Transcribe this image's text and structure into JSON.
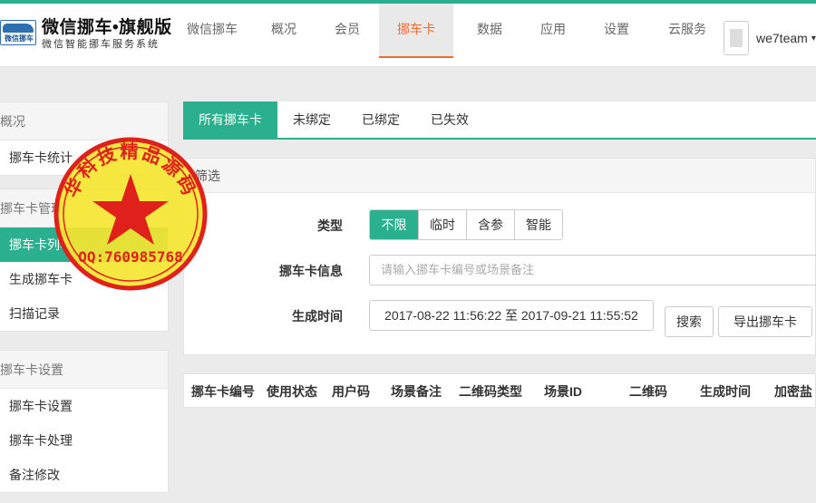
{
  "header": {
    "logo_text": "微信挪车",
    "title": "微信挪车•旗舰版",
    "subtitle": "微信智能挪车服务系统",
    "nav": [
      {
        "label": "微信挪车"
      },
      {
        "label": "概况"
      },
      {
        "label": "会员"
      },
      {
        "label": "挪车卡"
      },
      {
        "label": "数据"
      },
      {
        "label": "应用"
      },
      {
        "label": "设置"
      },
      {
        "label": "云服务"
      }
    ],
    "active_nav": "挪车卡",
    "username": "we7team",
    "caret": "▾"
  },
  "sidebar": {
    "sections": [
      {
        "title": "概况",
        "items": [
          "挪车卡统计"
        ]
      },
      {
        "title": "挪车卡管理",
        "items": [
          "挪车卡列表",
          "生成挪车卡",
          "扫描记录"
        ]
      },
      {
        "title": "挪车卡设置",
        "items": [
          "挪车卡设置",
          "挪车卡处理",
          "备注修改"
        ]
      }
    ],
    "active_item": "挪车卡列表"
  },
  "tabs": [
    "所有挪车卡",
    "未绑定",
    "已绑定",
    "已失效"
  ],
  "filter": {
    "heading": "筛选",
    "type_label": "类型",
    "type_options": [
      "不限",
      "临时",
      "含参",
      "智能"
    ],
    "info_label": "挪车卡信息",
    "info_placeholder": "请输入挪车卡编号或场景备注",
    "time_label": "生成时间",
    "time_range": "2017-08-22 11:56:22 至 2017-09-21 11:55:52",
    "search_button": "搜索",
    "export_button": "导出挪车卡"
  },
  "table": {
    "columns": [
      "挪车卡编号",
      "使用状态",
      "用户码",
      "场景备注",
      "二维码类型",
      "场景ID",
      "二维码",
      "生成时间",
      "加密盐"
    ]
  },
  "stamp": {
    "text": "华科技精品源码",
    "qq": "QQ:760985768"
  },
  "colors": {
    "accent": "#2bb08f",
    "nav_active": "#f36a2b",
    "stamp_red": "#e0201a",
    "stamp_yellow": "#f5e531"
  }
}
